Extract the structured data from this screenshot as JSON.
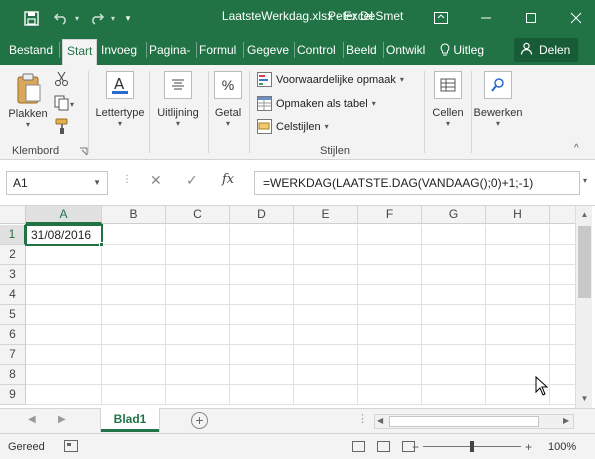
{
  "window": {
    "title": "LaatsteWerkdag.xlsx - Excel",
    "user": "Peter DeSmet"
  },
  "tabs": [
    "Bestand",
    "Start",
    "Invoeg",
    "Pagina-",
    "Formul",
    "Gegeve",
    "Control",
    "Beeld",
    "Ontwikl"
  ],
  "tell_me": "Uitleg",
  "share_label": "Delen",
  "ribbon": {
    "clipboard": {
      "paste_label": "Plakken",
      "group_label": "Klembord"
    },
    "font_label": "Lettertype",
    "alignment_label": "Uitlijning",
    "number_label": "Getal",
    "styles": {
      "conditional": "Voorwaardelijke opmaak",
      "table": "Opmaken als tabel",
      "cell_styles": "Celstijlen",
      "group_label": "Stijlen"
    },
    "cells_label": "Cellen",
    "editing_label": "Bewerken"
  },
  "formula_bar": {
    "name_box": "A1",
    "fx": "fx",
    "formula": "=WERKDAG(LAATSTE.DAG(VANDAAG();0)+1;-1)"
  },
  "grid": {
    "columns": [
      "A",
      "B",
      "C",
      "D",
      "E",
      "F",
      "G",
      "H"
    ],
    "rows": [
      "1",
      "2",
      "3",
      "4",
      "5",
      "6",
      "7",
      "8",
      "9"
    ],
    "a1_value": "31/08/2016"
  },
  "sheet_tab": "Blad1",
  "status": {
    "ready": "Gereed",
    "zoom_percent": "100%",
    "zoom_minus": "−",
    "zoom_plus": "+"
  },
  "colors": {
    "excel_green": "#217346",
    "dark_green": "#185c37"
  }
}
